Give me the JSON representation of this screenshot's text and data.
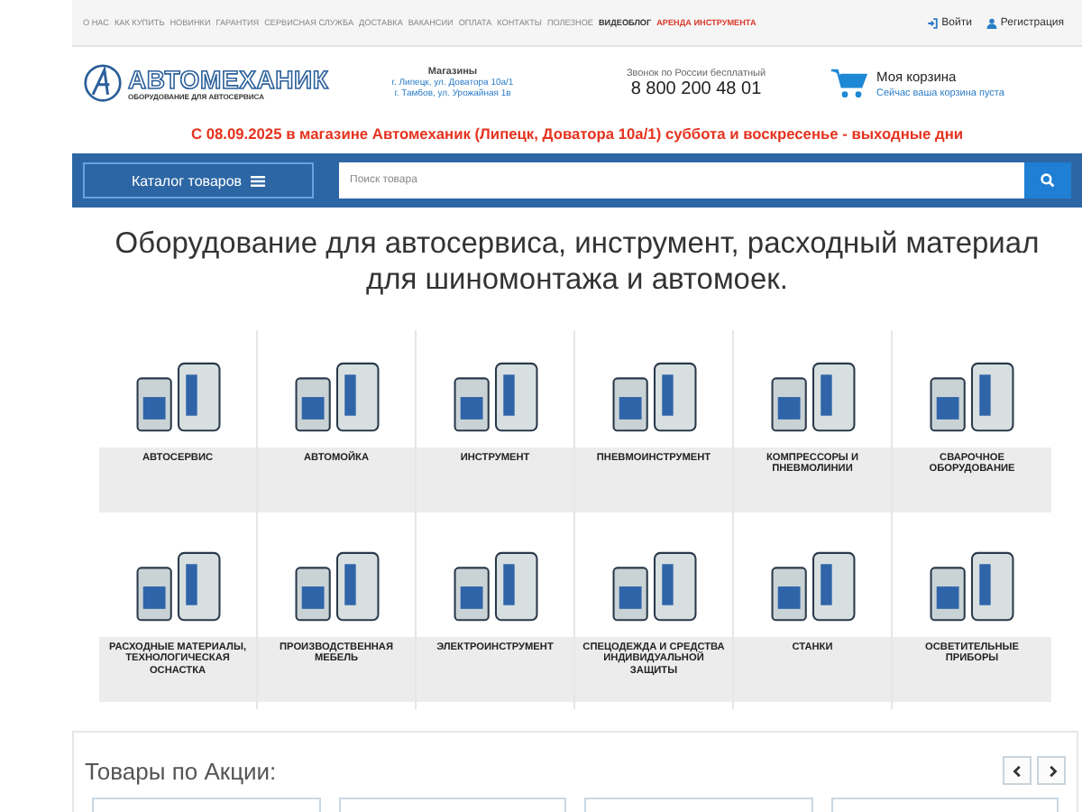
{
  "top_menu": [
    {
      "label": "О НАС",
      "kind": "plain"
    },
    {
      "label": "КАК КУПИТЬ",
      "kind": "plain"
    },
    {
      "label": "НОВИНКИ",
      "kind": "plain"
    },
    {
      "label": "ГАРАНТИЯ",
      "kind": "plain"
    },
    {
      "label": "СЕРВИСНАЯ СЛУЖБА",
      "kind": "plain"
    },
    {
      "label": "ДОСТАВКА",
      "kind": "plain"
    },
    {
      "label": "ВАКАНСИИ",
      "kind": "plain"
    },
    {
      "label": "ОПЛАТА",
      "kind": "plain"
    },
    {
      "label": "КОНТАКТЫ",
      "kind": "plain"
    },
    {
      "label": "ПОЛЕЗНОЕ",
      "kind": "plain"
    },
    {
      "label": "ВИДЕОБЛОГ",
      "kind": "bold"
    },
    {
      "label": "АРЕНДА ИНСТРУМЕНТА",
      "kind": "accent"
    }
  ],
  "account": {
    "login": "Войти",
    "register": "Регистрация"
  },
  "logo": {
    "name": "АВТОМЕХАНИК",
    "tagline": "ОБОРУДОВАНИЕ ДЛЯ АВТОСЕРВИСА"
  },
  "stores": {
    "title": "Магазины",
    "addresses": [
      "г. Липецк, ул. Доватора 10а/1",
      "г. Тамбов, ул. Урожайная 1в"
    ]
  },
  "phone": {
    "caption": "Звонок по России бесплатный",
    "number": "8 800 200 48 01"
  },
  "cart": {
    "title": "Моя корзина",
    "status": "Сейчас ваша корзина пуста"
  },
  "notice": "С 08.09.2025 в магазине Автомеханик (Липецк, Доватора 10а/1) суббота и воскресенье - выходные дни",
  "catalog_button": "Каталог товаров",
  "search": {
    "placeholder": "Поиск товара"
  },
  "heading": "Оборудование для автосервиса, инструмент, расходный материал для шиномонтажа и автомоек.",
  "categories": [
    {
      "label": "АВТОСЕРВИС"
    },
    {
      "label": "АВТОМОЙКА"
    },
    {
      "label": "ИНСТРУМЕНТ"
    },
    {
      "label": "ПНЕВМОИНСТРУМЕНТ"
    },
    {
      "label": "КОМПРЕССОРЫ И ПНЕВМОЛИНИИ"
    },
    {
      "label": "СВАРОЧНОЕ ОБОРУДОВАНИЕ"
    },
    {
      "label": "РАСХОДНЫЕ МАТЕРИАЛЫ, ТЕХНОЛОГИЧЕСКАЯ ОСНАСТКА"
    },
    {
      "label": "ПРОИЗВОДСТВЕННАЯ МЕБЕЛЬ"
    },
    {
      "label": "ЭЛЕКТРОИНСТРУМЕНТ"
    },
    {
      "label": "СПЕЦОДЕЖДА И СРЕДСТВА ИНДИВИДУАЛЬНОЙ ЗАЩИТЫ"
    },
    {
      "label": "СТАНКИ"
    },
    {
      "label": "ОСВЕТИТЕЛЬНЫЕ ПРИБОРЫ"
    }
  ],
  "promo": {
    "title": "Товары по Акции:"
  }
}
